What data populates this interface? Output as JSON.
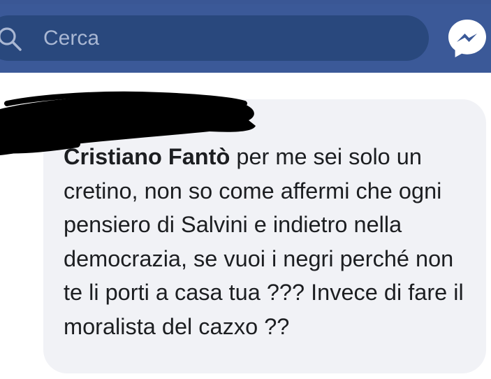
{
  "header": {
    "search": {
      "placeholder": "Cerca"
    },
    "icons": {
      "search": "search-icon",
      "messenger": "messenger-icon"
    },
    "colors": {
      "bar": "#3b5998",
      "search_field": "#29487d",
      "placeholder": "#a9b7d3"
    }
  },
  "comment": {
    "author": "Cristiano Fantò",
    "body": " per me sei solo un cretino, non so come affermi che ogni pensiero di Salvini e indietro nella democrazia, se vuoi i negri perché non te li porti a casa tua ??? Invece di fare il moralista del cazxo ??",
    "bubble_color": "#f1f2f6"
  }
}
